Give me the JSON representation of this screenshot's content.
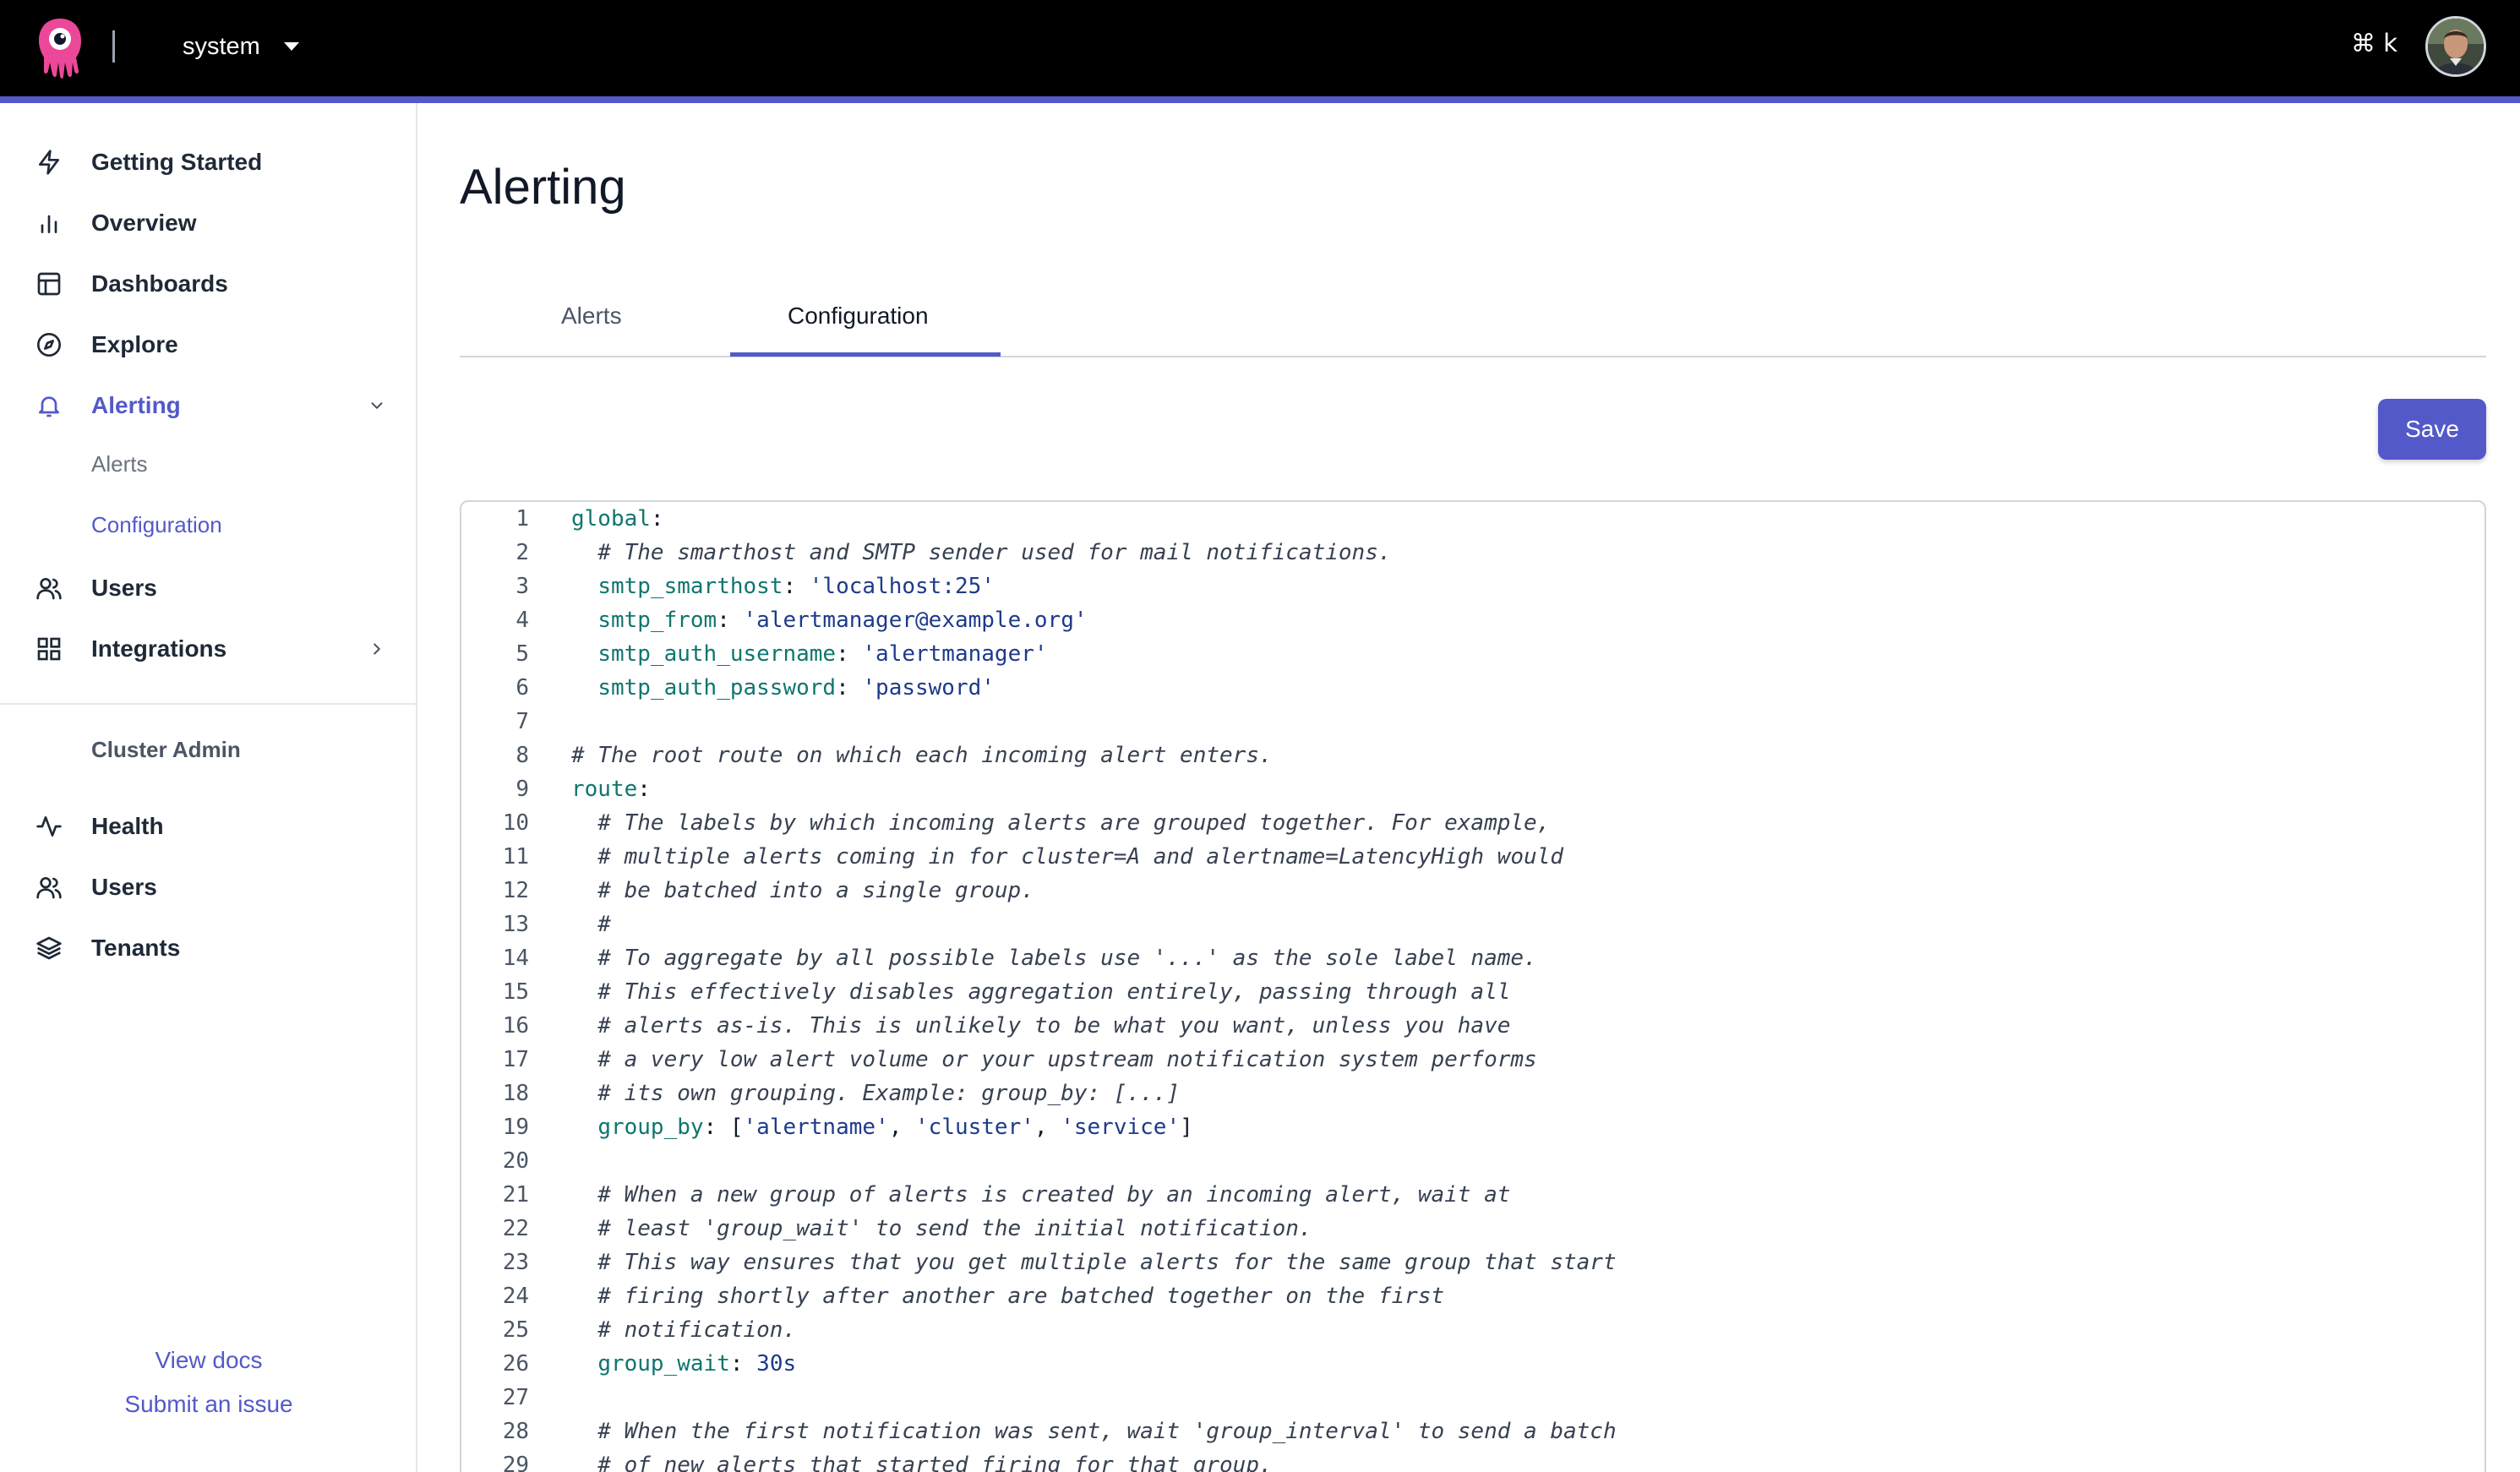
{
  "header": {
    "tenant": "system",
    "shortcut": "⌘ k",
    "brand_color": "#5359c9"
  },
  "sidebar": {
    "items": [
      {
        "label": "Getting Started",
        "icon": "bolt-icon"
      },
      {
        "label": "Overview",
        "icon": "bar-chart-icon"
      },
      {
        "label": "Dashboards",
        "icon": "layout-icon"
      },
      {
        "label": "Explore",
        "icon": "compass-icon"
      },
      {
        "label": "Alerting",
        "icon": "bell-icon"
      },
      {
        "label": "Users",
        "icon": "users-icon"
      },
      {
        "label": "Integrations",
        "icon": "grid-icon"
      }
    ],
    "alerting_sub": [
      "Alerts",
      "Configuration"
    ],
    "cluster_admin_title": "Cluster Admin",
    "cluster_admin_items": [
      {
        "label": "Health",
        "icon": "activity-icon"
      },
      {
        "label": "Users",
        "icon": "users-icon"
      },
      {
        "label": "Tenants",
        "icon": "layers-icon"
      }
    ],
    "footer": {
      "docs": "View docs",
      "issue": "Submit an issue"
    }
  },
  "main": {
    "title": "Alerting",
    "tabs": [
      "Alerts",
      "Configuration"
    ],
    "active_tab": "Configuration",
    "save_label": "Save"
  },
  "editor": {
    "lines": [
      {
        "n": "1",
        "parts": [
          [
            "k",
            "global"
          ],
          [
            "p",
            ":"
          ]
        ]
      },
      {
        "n": "2",
        "parts": [
          [
            "c",
            "  # The smarthost and SMTP sender used for mail notifications."
          ]
        ]
      },
      {
        "n": "3",
        "parts": [
          [
            "p",
            "  "
          ],
          [
            "k",
            "smtp_smarthost"
          ],
          [
            "p",
            ": "
          ],
          [
            "s",
            "'localhost:25'"
          ]
        ]
      },
      {
        "n": "4",
        "parts": [
          [
            "p",
            "  "
          ],
          [
            "k",
            "smtp_from"
          ],
          [
            "p",
            ": "
          ],
          [
            "s",
            "'alertmanager@example.org'"
          ]
        ]
      },
      {
        "n": "5",
        "parts": [
          [
            "p",
            "  "
          ],
          [
            "k",
            "smtp_auth_username"
          ],
          [
            "p",
            ": "
          ],
          [
            "s",
            "'alertmanager'"
          ]
        ]
      },
      {
        "n": "6",
        "parts": [
          [
            "p",
            "  "
          ],
          [
            "k",
            "smtp_auth_password"
          ],
          [
            "p",
            ": "
          ],
          [
            "s",
            "'password'"
          ]
        ]
      },
      {
        "n": "7",
        "parts": []
      },
      {
        "n": "8",
        "parts": [
          [
            "c",
            "# The root route on which each incoming alert enters."
          ]
        ]
      },
      {
        "n": "9",
        "parts": [
          [
            "k",
            "route"
          ],
          [
            "p",
            ":"
          ]
        ]
      },
      {
        "n": "10",
        "parts": [
          [
            "c",
            "  # The labels by which incoming alerts are grouped together. For example,"
          ]
        ]
      },
      {
        "n": "11",
        "parts": [
          [
            "c",
            "  # multiple alerts coming in for cluster=A and alertname=LatencyHigh would"
          ]
        ]
      },
      {
        "n": "12",
        "parts": [
          [
            "c",
            "  # be batched into a single group."
          ]
        ]
      },
      {
        "n": "13",
        "parts": [
          [
            "c",
            "  #"
          ]
        ]
      },
      {
        "n": "14",
        "parts": [
          [
            "c",
            "  # To aggregate by all possible labels use '...' as the sole label name."
          ]
        ]
      },
      {
        "n": "15",
        "parts": [
          [
            "c",
            "  # This effectively disables aggregation entirely, passing through all"
          ]
        ]
      },
      {
        "n": "16",
        "parts": [
          [
            "c",
            "  # alerts as-is. This is unlikely to be what you want, unless you have"
          ]
        ]
      },
      {
        "n": "17",
        "parts": [
          [
            "c",
            "  # a very low alert volume or your upstream notification system performs"
          ]
        ]
      },
      {
        "n": "18",
        "parts": [
          [
            "c",
            "  # its own grouping. Example: group_by: [...]"
          ]
        ]
      },
      {
        "n": "19",
        "parts": [
          [
            "p",
            "  "
          ],
          [
            "k",
            "group_by"
          ],
          [
            "p",
            ": ["
          ],
          [
            "s",
            "'alertname'"
          ],
          [
            "p",
            ", "
          ],
          [
            "s",
            "'cluster'"
          ],
          [
            "p",
            ", "
          ],
          [
            "s",
            "'service'"
          ],
          [
            "p",
            "]"
          ]
        ]
      },
      {
        "n": "20",
        "parts": []
      },
      {
        "n": "21",
        "parts": [
          [
            "c",
            "  # When a new group of alerts is created by an incoming alert, wait at"
          ]
        ]
      },
      {
        "n": "22",
        "parts": [
          [
            "c",
            "  # least 'group_wait' to send the initial notification."
          ]
        ]
      },
      {
        "n": "23",
        "parts": [
          [
            "c",
            "  # This way ensures that you get multiple alerts for the same group that start"
          ]
        ]
      },
      {
        "n": "24",
        "parts": [
          [
            "c",
            "  # firing shortly after another are batched together on the first"
          ]
        ]
      },
      {
        "n": "25",
        "parts": [
          [
            "c",
            "  # notification."
          ]
        ]
      },
      {
        "n": "26",
        "parts": [
          [
            "p",
            "  "
          ],
          [
            "k",
            "group_wait"
          ],
          [
            "p",
            ": "
          ],
          [
            "n",
            "30s"
          ]
        ]
      },
      {
        "n": "27",
        "parts": []
      },
      {
        "n": "28",
        "parts": [
          [
            "c",
            "  # When the first notification was sent, wait 'group_interval' to send a batch"
          ]
        ]
      },
      {
        "n": "29",
        "parts": [
          [
            "c",
            "  # of new alerts that started firing for that group."
          ]
        ]
      }
    ]
  }
}
